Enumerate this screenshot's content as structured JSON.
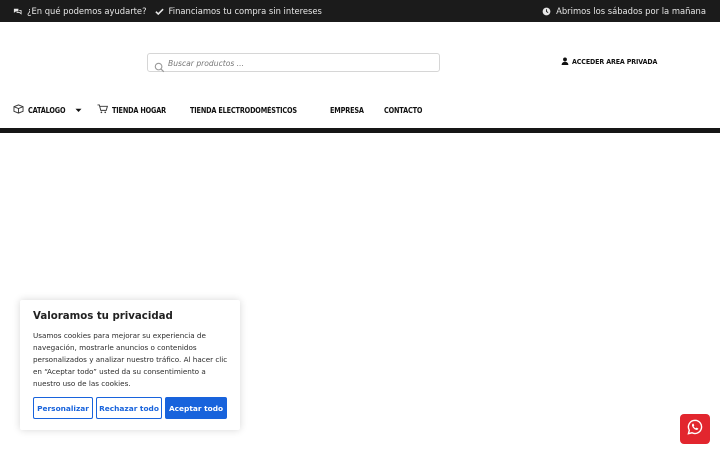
{
  "topbar": {
    "help_text": "¿En qué podemos ayudarte?",
    "help_icon": "chat-bubbles-icon",
    "finance_text": "Financiamos tu compra sin intereses",
    "finance_icon": "check-icon",
    "schedule_text": "Abrimos los sábados por la mañana",
    "schedule_icon": "clock-icon"
  },
  "search": {
    "placeholder": "Buscar productos ...",
    "value": "",
    "icon": "search-icon"
  },
  "account": {
    "label": "ACCEDER AREA PRIVADA",
    "icon": "user-icon"
  },
  "nav": {
    "items": [
      {
        "label": "CATÁLOGO",
        "icon": "box-icon",
        "dropdown": true
      },
      {
        "label": "TIENDA HOGAR",
        "icon": "cart-icon"
      },
      {
        "label": "TIENDA ELECTRODOMÉSTICOS"
      },
      {
        "label": "EMPRESA"
      },
      {
        "label": "CONTACTO"
      }
    ]
  },
  "cookie_banner": {
    "title": "Valoramos tu privacidad",
    "text": "Usamos cookies para mejorar su experiencia de navegación, mostrarle anuncios o contenidos personalizados y analizar nuestro tráfico. Al hacer clic en “Aceptar todo” usted da su consentimiento a nuestro uso de las cookies.",
    "buttons": {
      "customize": "Personalizar",
      "reject": "Rechazar todo",
      "accept": "Aceptar todo"
    }
  },
  "whatsapp": {
    "icon": "whatsapp-icon",
    "color": "#e2262e"
  },
  "colors": {
    "topbar_bg": "#1b1b1b",
    "accent_blue": "#1863dc",
    "nav_divider": "#161616"
  }
}
